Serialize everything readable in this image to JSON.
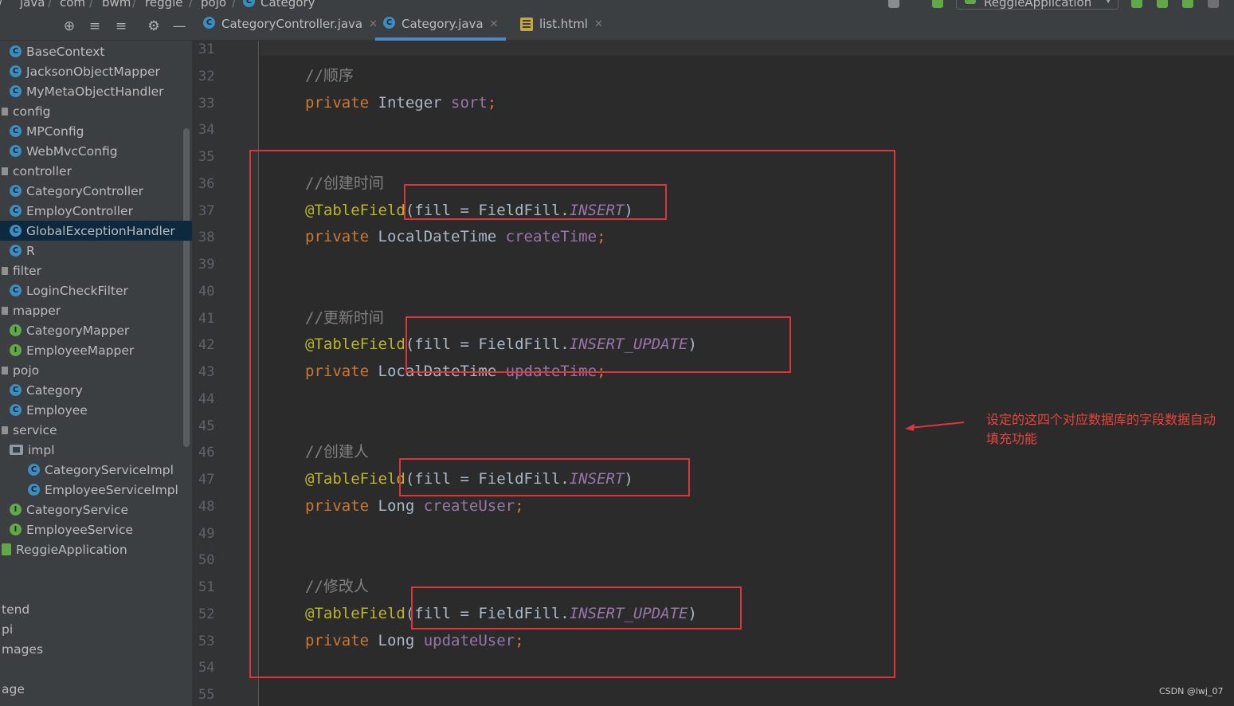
{
  "breadcrumb": [
    "java",
    "com",
    "bwm",
    "reggie",
    "pojo",
    "Category"
  ],
  "run_config": {
    "label": "ReggieApplication"
  },
  "tabs": [
    {
      "label": "CategoryController.java",
      "icon": "class-icon",
      "active": false
    },
    {
      "label": "Category.java",
      "icon": "class-icon",
      "active": true
    },
    {
      "label": "list.html",
      "icon": "html-file-icon",
      "active": false
    }
  ],
  "tree": {
    "items": [
      {
        "label": "BaseContext",
        "icon": "class-icon",
        "indent": 1
      },
      {
        "label": "JacksonObjectMapper",
        "icon": "class-icon",
        "indent": 1
      },
      {
        "label": "MyMetaObjectHandler",
        "icon": "class-icon",
        "indent": 1
      },
      {
        "label": "config",
        "icon": "package-icon",
        "indent": 0
      },
      {
        "label": "MPConfig",
        "icon": "class-icon",
        "indent": 1
      },
      {
        "label": "WebMvcConfig",
        "icon": "class-icon",
        "indent": 1
      },
      {
        "label": "controller",
        "icon": "package-icon",
        "indent": 0
      },
      {
        "label": "CategoryController",
        "icon": "class-icon",
        "indent": 1
      },
      {
        "label": "EmployController",
        "icon": "class-icon",
        "indent": 1
      },
      {
        "label": "GlobalExceptionHandler",
        "icon": "class-icon",
        "indent": 1,
        "selected": true
      },
      {
        "label": "R",
        "icon": "class-icon",
        "indent": 1
      },
      {
        "label": "filter",
        "icon": "package-icon",
        "indent": 0
      },
      {
        "label": "LoginCheckFilter",
        "icon": "class-icon",
        "indent": 1
      },
      {
        "label": "mapper",
        "icon": "package-icon",
        "indent": 0
      },
      {
        "label": "CategoryMapper",
        "icon": "interface-icon",
        "indent": 1
      },
      {
        "label": "EmployeeMapper",
        "icon": "interface-icon",
        "indent": 1
      },
      {
        "label": "pojo",
        "icon": "package-icon",
        "indent": 0
      },
      {
        "label": "Category",
        "icon": "class-icon",
        "indent": 1
      },
      {
        "label": "Employee",
        "icon": "class-icon",
        "indent": 1
      },
      {
        "label": "service",
        "icon": "package-icon",
        "indent": 0
      },
      {
        "label": "impl",
        "icon": "folder-icon",
        "indent": 1
      },
      {
        "label": "CategoryServiceImpl",
        "icon": "class-icon",
        "indent": 2
      },
      {
        "label": "EmployeeServiceImpl",
        "icon": "class-icon",
        "indent": 2
      },
      {
        "label": "CategoryService",
        "icon": "interface-icon",
        "indent": 1
      },
      {
        "label": "EmployeeService",
        "icon": "interface-icon",
        "indent": 1
      },
      {
        "label": "ReggieApplication",
        "icon": "spring-app-icon",
        "indent": 0
      },
      {
        "label": "",
        "icon": "",
        "indent": 0
      },
      {
        "label": "",
        "icon": "",
        "indent": 0
      },
      {
        "label": "tend",
        "icon": "",
        "indent": 0
      },
      {
        "label": "pi",
        "icon": "",
        "indent": 0
      },
      {
        "label": "mages",
        "icon": "",
        "indent": 0
      },
      {
        "label": "",
        "icon": "",
        "indent": 0
      },
      {
        "label": "age",
        "icon": "",
        "indent": 0
      }
    ]
  },
  "editor": {
    "line_numbers": [
      "31",
      "32",
      "33",
      "34",
      "35",
      "36",
      "37",
      "38",
      "39",
      "40",
      "41",
      "42",
      "43",
      "44",
      "45",
      "46",
      "47",
      "48",
      "49",
      "50",
      "51",
      "52",
      "53",
      "54",
      "55"
    ],
    "lines": [
      "",
      "//顺序",
      "private Integer sort;",
      "",
      "",
      "//创建时间",
      "@TableField(fill = FieldFill.INSERT)",
      "private LocalDateTime createTime;",
      "",
      "",
      "//更新时间",
      "@TableField(fill = FieldFill.INSERT_UPDATE)",
      "private LocalDateTime updateTime;",
      "",
      "",
      "//创建人",
      "@TableField(fill = FieldFill.INSERT)",
      "private Long createUser;",
      "",
      "",
      "//修改人",
      "@TableField(fill = FieldFill.INSERT_UPDATE)",
      "private Long updateUser;",
      "",
      ""
    ]
  },
  "annotation": {
    "note": "设定的这四个对应数据库的字段数据自动填充功能",
    "color": "#e0343b"
  },
  "watermark": "CSDN @lwj_07",
  "colors": {
    "keyword": "#cc7832",
    "annotation": "#bbb529",
    "field": "#9876aa",
    "comment": "#808080",
    "text": "#a9b7c6",
    "accent": "#4a88c7"
  }
}
